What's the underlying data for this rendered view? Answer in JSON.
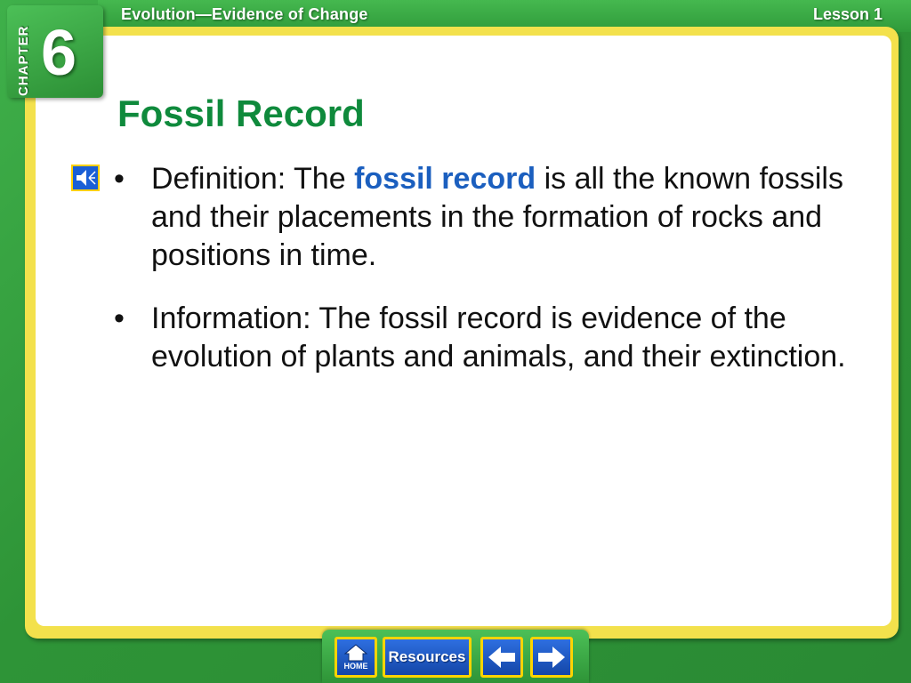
{
  "header": {
    "title": "Evolution—Evidence of Change",
    "lesson": "Lesson 1"
  },
  "chapter": {
    "word": "CHAPTER",
    "number": "6"
  },
  "slide": {
    "title": "Fossil Record",
    "bullets": [
      {
        "lead": "Definition:  The ",
        "term": "fossil record",
        "rest": " is all the known fossils and their placements in the formation of rocks and positions in time."
      },
      {
        "text": "Information:  The fossil record is evidence of the evolution of plants and animals, and their extinction."
      }
    ]
  },
  "nav": {
    "home_label": "HOME",
    "resources_label": "Resources"
  },
  "colors": {
    "frame_green": "#2f9a3a",
    "border_yellow": "#f3e14c",
    "title_green": "#0f8a3c",
    "term_blue": "#1b5fbf",
    "button_blue": "#1a5fd6"
  },
  "icons": {
    "audio": "speaker-icon",
    "home": "house-icon",
    "prev": "arrow-left-icon",
    "next": "arrow-right-icon"
  }
}
